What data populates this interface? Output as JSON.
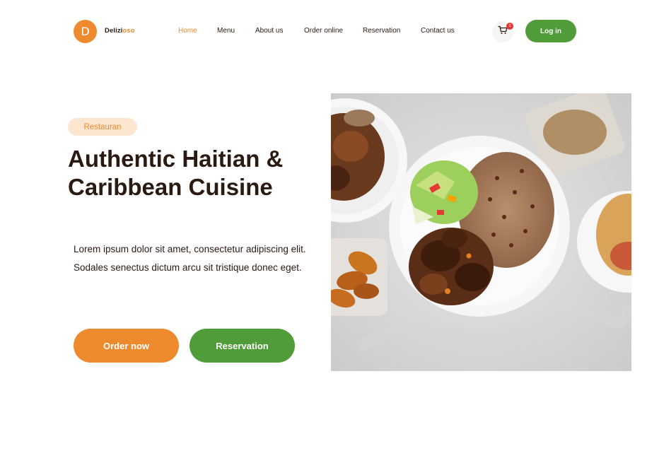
{
  "brand": {
    "initial": "D",
    "name_part1": "Delizi",
    "name_part2": "oso"
  },
  "nav": {
    "items": [
      {
        "label": "Home",
        "active": true
      },
      {
        "label": "Menu",
        "active": false
      },
      {
        "label": "About us",
        "active": false
      },
      {
        "label": "Order online",
        "active": false
      },
      {
        "label": "Reservation",
        "active": false
      },
      {
        "label": "Contact us",
        "active": false
      }
    ],
    "cart_count": "1",
    "cart_icon": "cart-icon",
    "login_label": "Log in"
  },
  "hero": {
    "tag": "Restauran",
    "title_line1": "Authentic Haitian &",
    "title_line2": "Caribbean Cuisine",
    "description": "Lorem ipsum dolor sit amet, consectetur adipiscing elit. Sodales senectus dictum arcu sit tristique donec eget.",
    "order_button": "Order now",
    "reservation_button": "Reservation",
    "image_subject": "plates of Caribbean food"
  },
  "colors": {
    "accent_orange": "#ed8a2e",
    "accent_green": "#4f9c39",
    "tag_bg": "#fde6cf",
    "text_dark": "#2a1a12"
  }
}
